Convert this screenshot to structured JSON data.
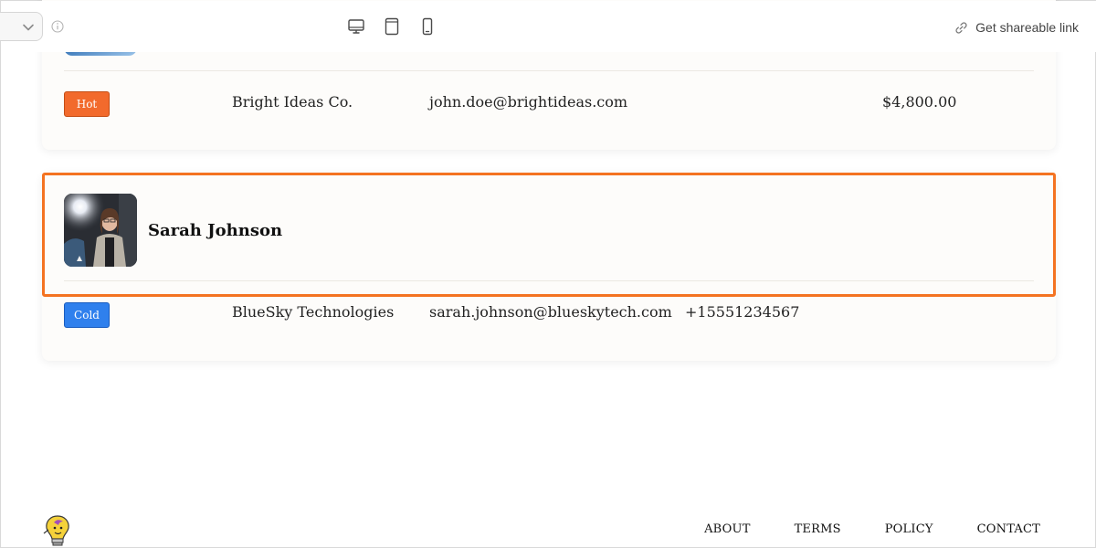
{
  "toolbar": {
    "share_label": "Get shareable link",
    "device_icons": [
      "desktop-icon",
      "tablet-icon",
      "mobile-icon"
    ]
  },
  "contacts": [
    {
      "status": "Hot",
      "company": "Bright Ideas Co.",
      "email": "john.doe@brightideas.com",
      "phone": "",
      "amount": "$4,800.00"
    },
    {
      "name": "Sarah Johnson",
      "status": "Cold",
      "company": "BlueSky Technologies",
      "email": "sarah.johnson@blueskytech.com",
      "phone": "+15551234567",
      "amount": ""
    }
  ],
  "footer": {
    "links": [
      "ABOUT",
      "TERMS",
      "POLICY",
      "CONTACT"
    ]
  },
  "colors": {
    "hot": "#f26a2c",
    "cold": "#2f80ed",
    "highlight": "#f47321",
    "card_bg": "#fdfcfa"
  }
}
